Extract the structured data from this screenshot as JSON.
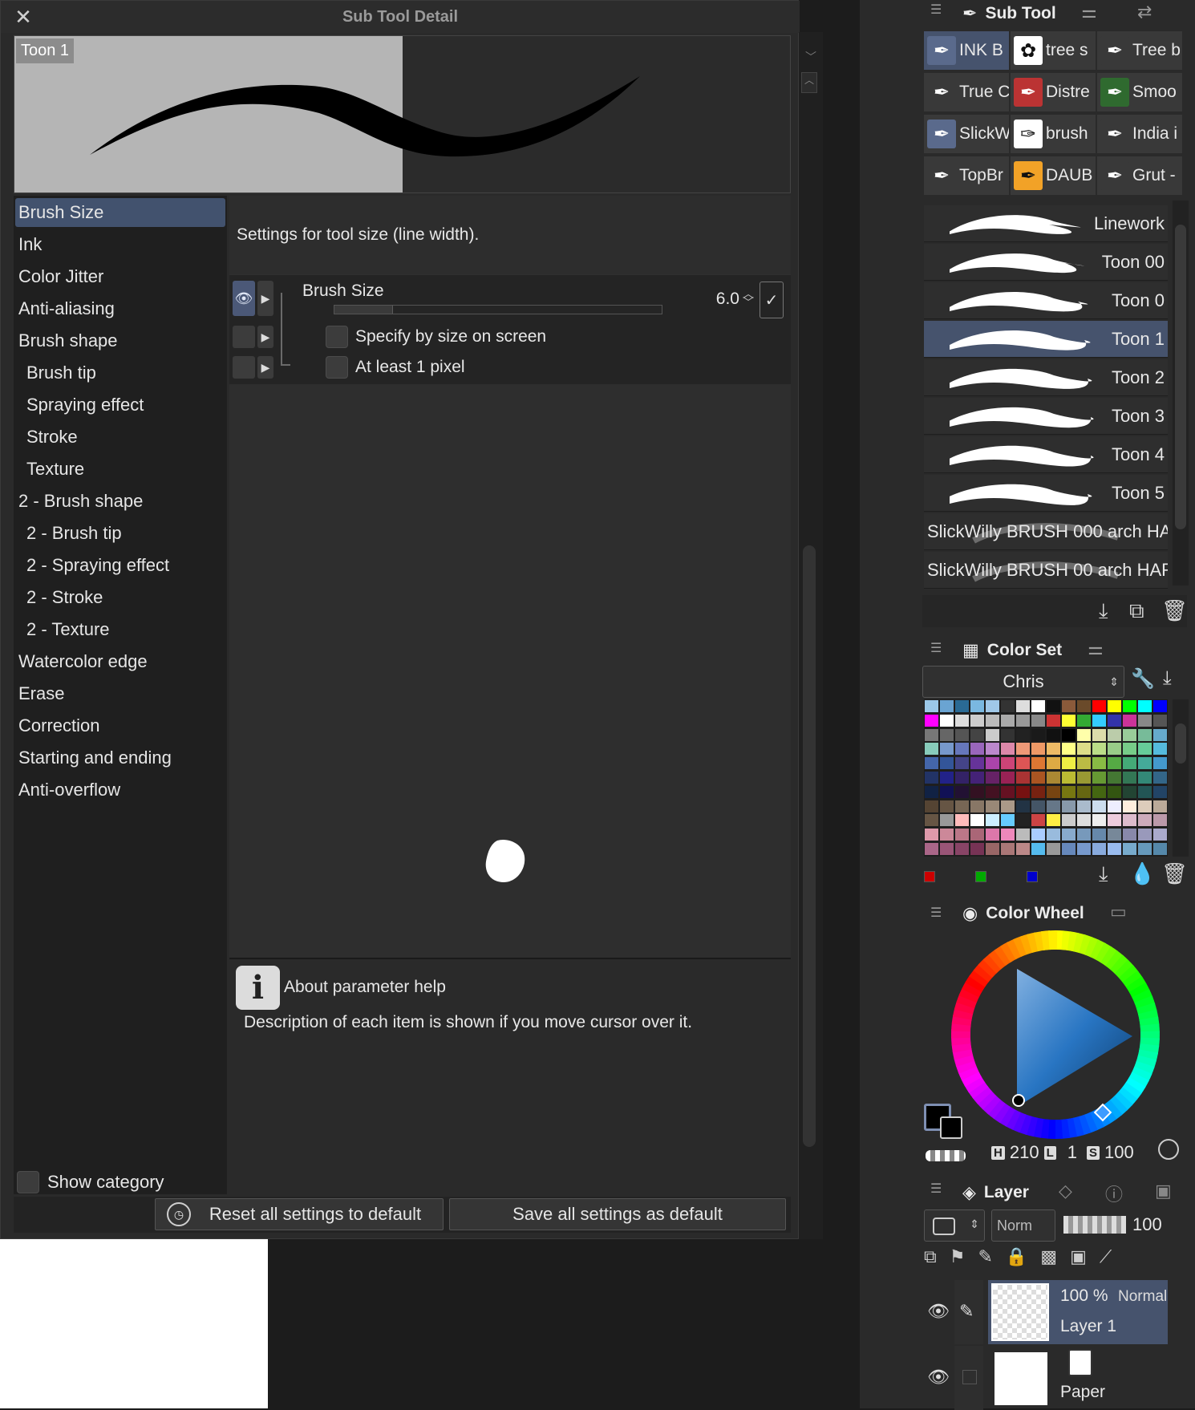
{
  "dialog": {
    "title": "Sub Tool Detail",
    "preview_label": "Toon 1",
    "categories": [
      {
        "label": "Brush Size",
        "sub": false,
        "selected": true
      },
      {
        "label": "Ink",
        "sub": false
      },
      {
        "label": "Color Jitter",
        "sub": false
      },
      {
        "label": "Anti-aliasing",
        "sub": false
      },
      {
        "label": "Brush shape",
        "sub": false
      },
      {
        "label": "Brush tip",
        "sub": true
      },
      {
        "label": "Spraying effect",
        "sub": true
      },
      {
        "label": "Stroke",
        "sub": true
      },
      {
        "label": "Texture",
        "sub": true
      },
      {
        "label": "2 - Brush shape",
        "sub": false
      },
      {
        "label": "2 - Brush tip",
        "sub": true
      },
      {
        "label": "2 - Spraying effect",
        "sub": true
      },
      {
        "label": "2 - Stroke",
        "sub": true
      },
      {
        "label": "2 - Texture",
        "sub": true
      },
      {
        "label": "Watercolor edge",
        "sub": false
      },
      {
        "label": "Erase",
        "sub": false
      },
      {
        "label": "Correction",
        "sub": false
      },
      {
        "label": "Starting and ending",
        "sub": false
      },
      {
        "label": "Anti-overflow",
        "sub": false
      }
    ],
    "description": "Settings for tool size (line width).",
    "brush_size_label": "Brush Size",
    "brush_size_value": "6.0",
    "brush_size_fraction": 0.18,
    "option_specify": "Specify by size on screen",
    "option_at_least": "At least 1 pixel",
    "help_title": "About parameter help",
    "help_text": "Description of each item is shown if you move cursor over it.",
    "show_category": "Show category",
    "reset_button": "Reset all settings to default",
    "save_button": "Save all settings as default"
  },
  "subtool": {
    "tab_label": "Sub Tool",
    "groups": [
      {
        "label": "INK B",
        "icon": "pen-icon",
        "selected": true
      },
      {
        "label": "tree s",
        "icon": "flower-icon"
      },
      {
        "label": "Tree b",
        "icon": "pen-icon"
      },
      {
        "label": "True C",
        "icon": "pen-icon"
      },
      {
        "label": "Distre",
        "icon": "pen-icon"
      },
      {
        "label": "Smoo",
        "icon": "pen-icon"
      },
      {
        "label": "SlickW",
        "icon": "pen-icon"
      },
      {
        "label": "brush",
        "icon": "brush-icon"
      },
      {
        "label": "India i",
        "icon": "pen-icon"
      },
      {
        "label": "TopBr",
        "icon": "pen-icon"
      },
      {
        "label": "DAUB",
        "icon": "pen-icon"
      },
      {
        "label": "Grut -",
        "icon": "pen-icon"
      }
    ],
    "brushes": [
      {
        "label": "Linework"
      },
      {
        "label": "Toon 00"
      },
      {
        "label": "Toon 0"
      },
      {
        "label": "Toon 1",
        "selected": true
      },
      {
        "label": "Toon 2"
      },
      {
        "label": "Toon 3"
      },
      {
        "label": "Toon 4"
      },
      {
        "label": "Toon 5"
      },
      {
        "label": "SlickWilly BRUSH 000 arch  HA"
      },
      {
        "label": "SlickWilly BRUSH 00 arch  HAR"
      }
    ]
  },
  "colorset": {
    "tab_label": "Color Set",
    "set_name": "Chris"
  },
  "colorwheel": {
    "tab_label": "Color Wheel",
    "h_label": "H",
    "h_value": "210",
    "l_label": "L",
    "l_value": "1",
    "s_label": "S",
    "s_value": "100"
  },
  "layers": {
    "tab_label": "Layer",
    "blend_mode": "Norm",
    "opacity": "100",
    "items": [
      {
        "opacity": "100 %",
        "mode": "Normal",
        "name": "Layer 1",
        "selected": true
      },
      {
        "name": "Paper"
      }
    ]
  },
  "colors": {
    "accent": "#46536d",
    "orange": "#f2a227"
  }
}
